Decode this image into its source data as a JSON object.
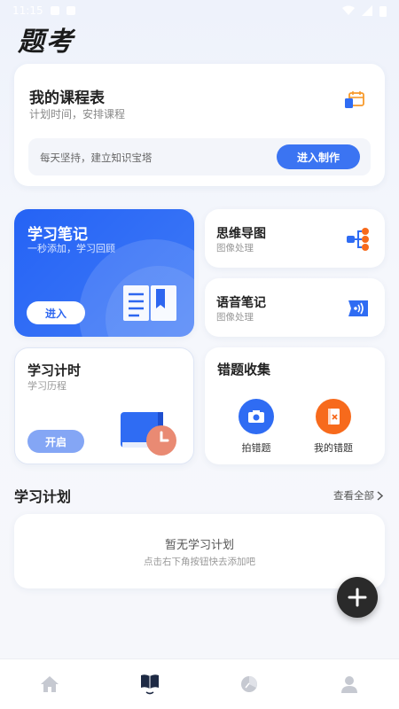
{
  "status_bar": {
    "time": "11:15"
  },
  "app": {
    "title": "题考"
  },
  "schedule": {
    "title": "我的课程表",
    "subtitle": "计划时间，安排课程",
    "tip": "每天坚持，建立知识宝塔",
    "button": "进入制作"
  },
  "notes": {
    "title": "学习笔记",
    "subtitle": "一秒添加，学习回顾",
    "button": "进入"
  },
  "mindmap": {
    "title": "思维导图",
    "subtitle": "图像处理"
  },
  "voice": {
    "title": "语音笔记",
    "subtitle": "图像处理"
  },
  "timer": {
    "title": "学习计时",
    "subtitle": "学习历程",
    "button": "开启"
  },
  "errors": {
    "title": "错题收集",
    "items": [
      {
        "label": "拍错题",
        "icon": "camera-icon",
        "color": "#2f6cf3"
      },
      {
        "label": "我的错题",
        "icon": "error-book-icon",
        "color": "#f76a1c"
      }
    ]
  },
  "plan": {
    "title": "学习计划",
    "more": "查看全部",
    "empty": "暂无学习计划",
    "hint": "点击右下角按钮快去添加吧"
  },
  "fab": {
    "icon": "plus-icon"
  },
  "nav": {
    "items": [
      {
        "icon": "home-icon",
        "active": false
      },
      {
        "icon": "study-book-icon",
        "active": true
      },
      {
        "icon": "stats-icon",
        "active": false
      },
      {
        "icon": "profile-icon",
        "active": false
      }
    ]
  },
  "colors": {
    "primary": "#3b74f2",
    "orange": "#f76a1c",
    "dark": "#2a2a2a"
  }
}
